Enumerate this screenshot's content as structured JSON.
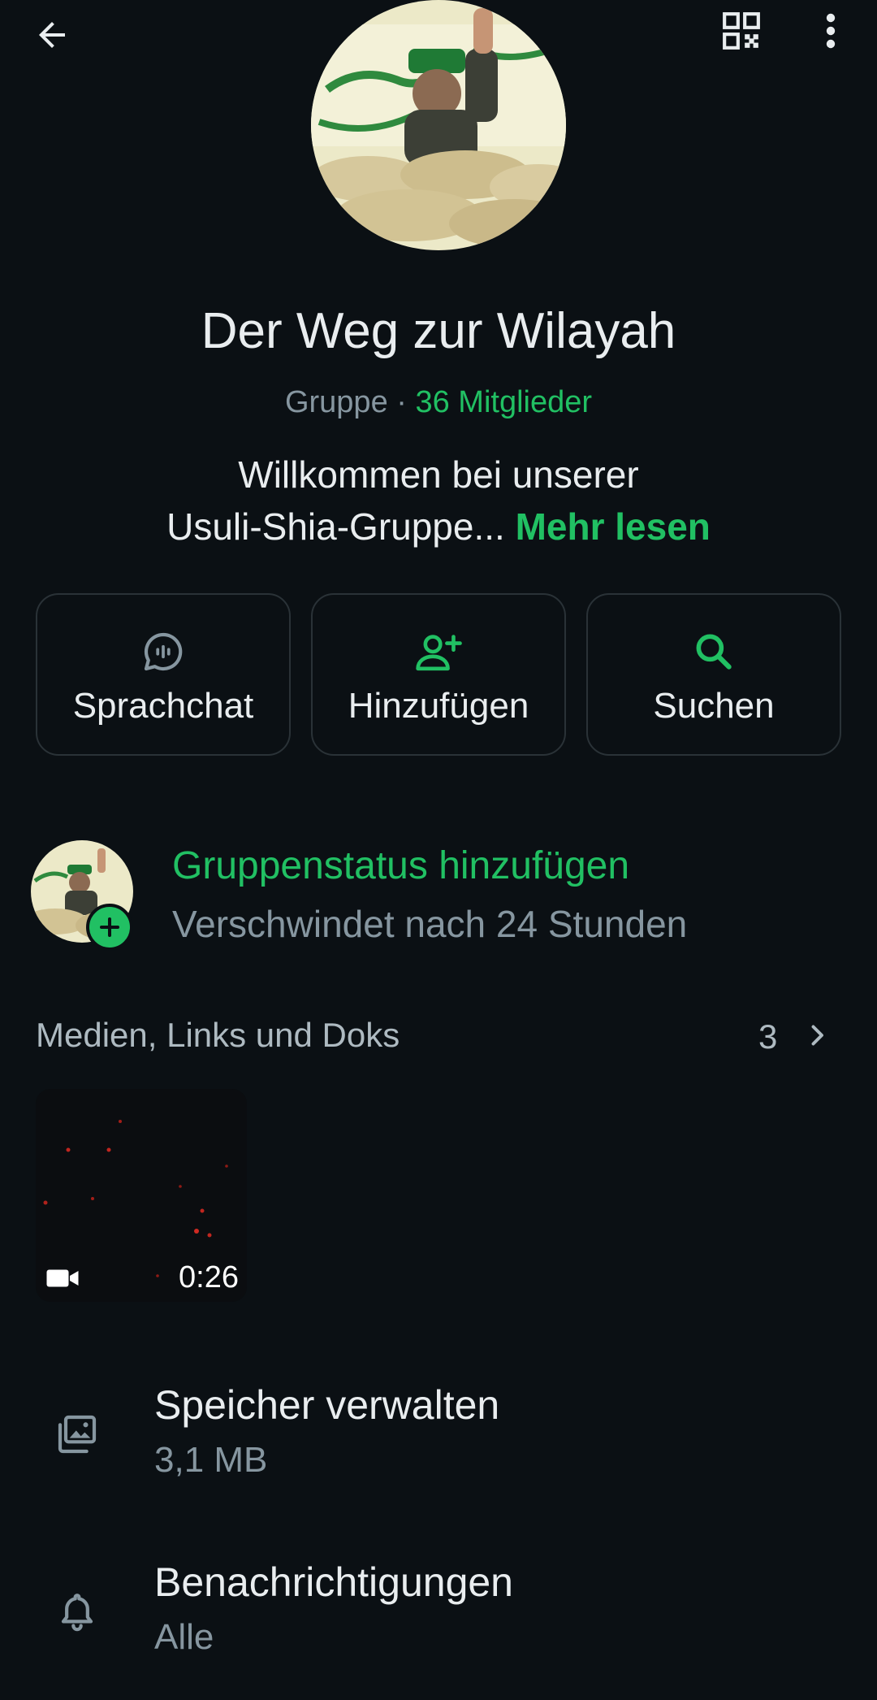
{
  "header": {
    "back_icon": "arrow-left-icon",
    "qr_icon": "qr-code-icon",
    "menu_icon": "more-vert-icon"
  },
  "group": {
    "title": "Der Weg zur Wilayah",
    "kind": "Gruppe",
    "separator": " · ",
    "members": "36 Mitglieder",
    "description_line1": "Willkommen bei unserer",
    "description_line2": "Usuli-Shia-Gruppe...",
    "read_more": "Mehr lesen"
  },
  "actions": [
    {
      "label": "Sprachchat",
      "icon": "voice-chat-icon"
    },
    {
      "label": "Hinzufügen",
      "icon": "add-person-icon"
    },
    {
      "label": "Suchen",
      "icon": "search-icon"
    }
  ],
  "status": {
    "title": "Gruppenstatus hinzufügen",
    "subtitle": "Verschwindet nach 24 Stunden"
  },
  "media": {
    "title": "Medien, Links und Doks",
    "count": "3",
    "items": [
      {
        "type": "video",
        "duration": "0:26"
      }
    ]
  },
  "settings": [
    {
      "title": "Speicher verwalten",
      "subtitle": "3,1 MB",
      "icon": "storage-icon"
    },
    {
      "title": "Benachrichtigungen",
      "subtitle": "Alle",
      "icon": "bell-icon"
    }
  ],
  "colors": {
    "background": "#0b1014",
    "accent": "#21c063",
    "text_primary": "#e9edef",
    "text_secondary": "#8696a0",
    "border": "#2a3237"
  }
}
